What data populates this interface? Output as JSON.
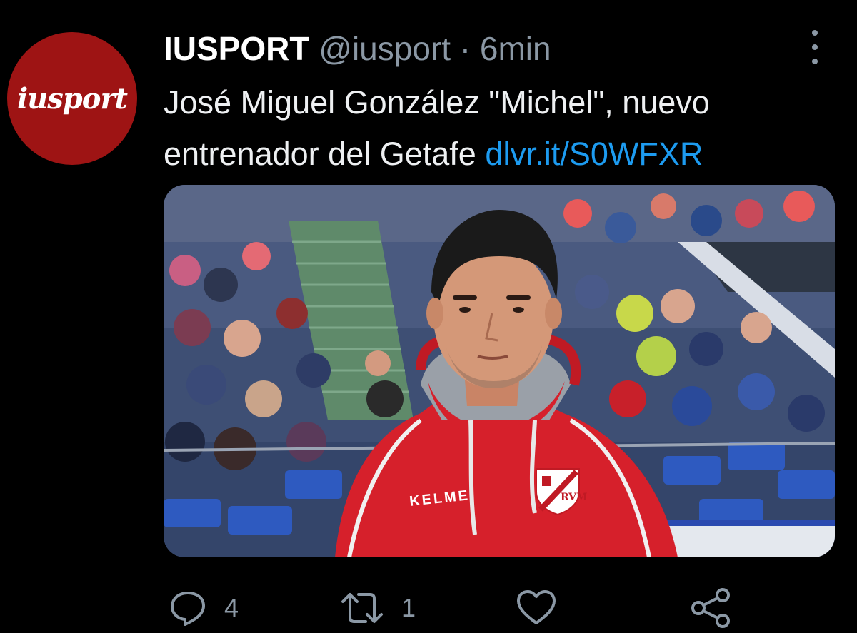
{
  "tweet": {
    "avatar_text": "iusport",
    "display_name": "IUSPORT",
    "handle": "@iusport",
    "separator": "·",
    "time": "6min",
    "text": "José Miguel González \"Michel\", nuevo entrenador del Getafe",
    "link": "dlvr.it/S0WFXR",
    "media": {
      "description": "Coach in red Rayo Vallecano hoodie at stadium",
      "hoodie_brand": "KELME",
      "crest_text": "RVM"
    },
    "actions": {
      "reply_count": "4",
      "retweet_count": "1",
      "like_count": "",
      "share_count": ""
    }
  },
  "colors": {
    "background": "#000000",
    "text": "#eef0f2",
    "secondary": "#8b98a5",
    "link": "#1d9bf0",
    "avatar_bg": "#9e1414",
    "hoodie": "#d6202b"
  }
}
